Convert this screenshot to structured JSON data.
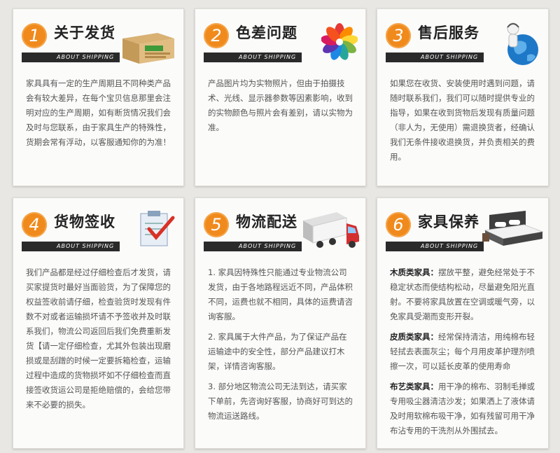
{
  "subtitle": "ABOUT SHIPPING",
  "cards": [
    {
      "num": "1",
      "title": "关于发货",
      "body": "家具具有一定的生产周期且不同种类产品会有较大差异，在每个宝贝信息那里会注明对应的生产周期，如有断货情况我们会及时与您联系，由于家具生产的特殊性，货期会常有浮动，以客服通知你的为准！"
    },
    {
      "num": "2",
      "title": "色差问题",
      "body": "产品图片均为实物照片，但由于拍摄技术、光线、显示器参数等因素影响，收到的实物颜色与照片会有差别，请以实物为准。"
    },
    {
      "num": "3",
      "title": "售后服务",
      "body": "如果您在收货、安装使用时遇到问题，请随时联系我们，我们可以随时提供专业的指导，如果在收到货物后发现有质量问题（非人为，无使用）需退换货者，经确认我们无条件接收退换货，并负责相关的费用。"
    },
    {
      "num": "4",
      "title": "货物签收",
      "body": "我们产品都是经过仔细检查后才发货，请买家提货时最好当面验货，为了保障您的权益签收前请仔细，检查验货时发现有件数不对或者运输损坏请不予签收并及时联系我们，物流公司返回后我们免费重新发货【请一定仔细检查，尤其外包装出现磨损或是刮蹭的时候一定要拆箱检查，运输过程中造成的货物损坏如不仔细检查而直接签收货运公司是拒绝赔偿的，会给您带来不必要的损失。"
    },
    {
      "num": "5",
      "title": "物流配送",
      "paras": [
        "1. 家具因特殊性只能通过专业物流公司发货，由于各地路程远近不同，产品体积不同，运费也就不相同，具体的运费请咨询客服。",
        "2. 家具属于大件产品，为了保证产品在运输途中的安全性，部分产品建议打木架，详情咨询客服。",
        "3. 部分地区物流公司无法到达，请买家下单前，先咨询好客服，协商好可到达的物流运送路线。"
      ]
    },
    {
      "num": "6",
      "title": "家具保养",
      "sections": [
        {
          "label": "木质类家具：",
          "text": "摆放平整，避免经常处于不稳定状态而使结构松动，尽量避免阳光直射。不要将家具放置在空调或暖气旁，以免家具受潮而变形开裂。"
        },
        {
          "label": "皮质类家具：",
          "text": "经常保持清洁，用纯棉布轻轻拭去表面灰尘；每个月用皮革护理剂喷擦一次，可以延长皮革的使用寿命"
        },
        {
          "label": "布艺类家具：",
          "text": "用干净的棉布、羽制毛掸或专用吸尘器清洁沙发；如果洒上了液体请及时用软棉布吸干净，如有残留可用干净布沾专用的干洗剂从外围拭去。"
        }
      ]
    }
  ],
  "colors": {
    "accent": "#f08a1c",
    "bar": "#2a2a2a",
    "background": "#e9e7e3"
  }
}
